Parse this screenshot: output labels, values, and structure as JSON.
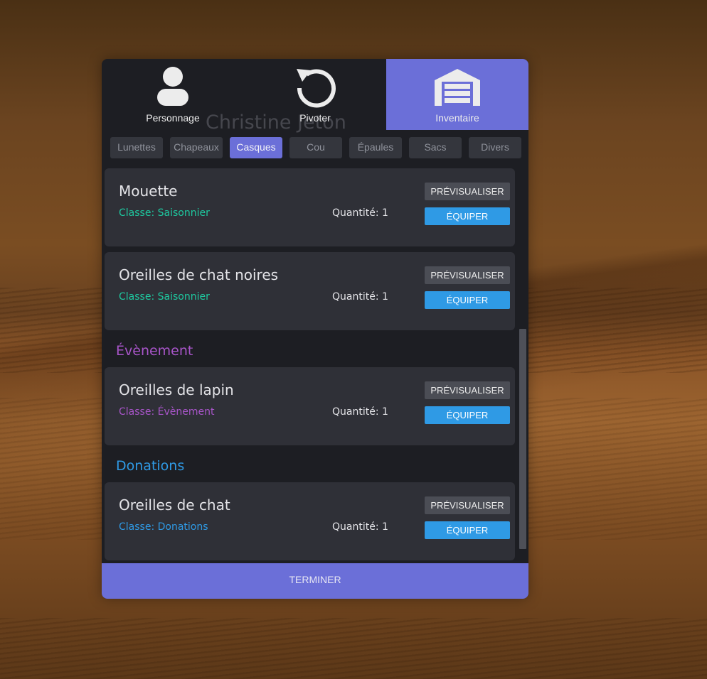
{
  "nav": {
    "items": [
      {
        "label": "Personnage",
        "icon": "user-icon"
      },
      {
        "label": "Pivoter",
        "icon": "rotate-icon"
      },
      {
        "label": "Inventaire",
        "icon": "garage-icon"
      }
    ],
    "active_index": 2
  },
  "background_name": "Christine Jeton",
  "categories": [
    "Lunettes",
    "Chapeaux",
    "Casques",
    "Cou",
    "Épaules",
    "Sacs",
    "Divers"
  ],
  "active_category": "Casques",
  "labels": {
    "preview": "PRÉVISUALISER",
    "equip": "ÉQUIPER",
    "quantity_prefix": "Quantité: 1"
  },
  "sections": [
    {
      "title": "Évènement",
      "color": "#a855c9"
    },
    {
      "title": "Donations",
      "color": "#2f9ae5"
    }
  ],
  "items": [
    {
      "name": "Mouette",
      "class": "Classe: Saisonnier",
      "class_color": "#1ec9a0",
      "quantity": "Quantité: 1"
    },
    {
      "name": "Oreilles de chat noires",
      "class": "Classe: Saisonnier",
      "class_color": "#1ec9a0",
      "quantity": "Quantité: 1"
    },
    {
      "name": "Oreilles de lapin",
      "class": "Classe: Évènement",
      "class_color": "#a855c9",
      "quantity": "Quantité: 1"
    },
    {
      "name": "Oreilles de chat",
      "class": "Classe: Donations",
      "class_color": "#2f9ae5",
      "quantity": "Quantité: 1"
    }
  ],
  "footer": {
    "label": "TERMINER"
  },
  "colors": {
    "accent": "#6b6fd8",
    "equip": "#2f9ae5",
    "panel": "#1d1e23",
    "card": "#2f3037"
  }
}
